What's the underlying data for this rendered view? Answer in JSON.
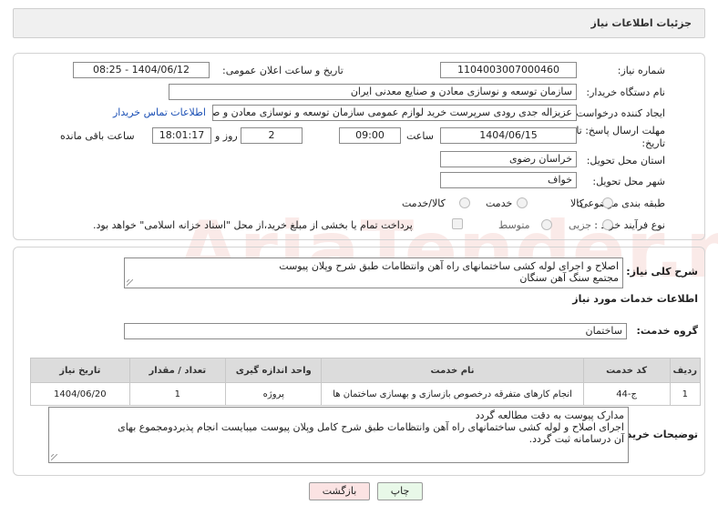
{
  "header": {
    "title": "جزئیات اطلاعات نیاز"
  },
  "need_number": {
    "label": "شماره نیاز:",
    "value": "1104003007000460"
  },
  "announce_datetime": {
    "label": "تاریخ و ساعت اعلان عمومی:",
    "value": "1404/06/12 - 08:25"
  },
  "buyer_org": {
    "label": "نام دستگاه خریدار:",
    "value": "سازمان توسعه و نوسازی معادن و صنایع معدنی ایران"
  },
  "requester": {
    "label": "ایجاد کننده درخواست:",
    "value": "عزیزاله جدی رودی سرپرست خرید لوازم عمومی  سازمان توسعه و نوسازی معادن و صنایع معدنی ایران",
    "contact_link": "اطلاعات تماس خریدار"
  },
  "deadline": {
    "label_line1": "مهلت ارسال پاسخ: تا",
    "label_line2": "تاریخ:",
    "date": "1404/06/15",
    "time_label": "ساعت",
    "time": "09:00",
    "days": "2",
    "days_label": "روز و",
    "remaining": "18:01:17",
    "remaining_label": "ساعت باقی مانده"
  },
  "province": {
    "label": "استان محل تحویل:",
    "value": "خراسان رضوی"
  },
  "city": {
    "label": "شهر محل تحویل:",
    "value": "خواف"
  },
  "category": {
    "label": "طبقه بندی موضوعی:",
    "options": [
      "کالا",
      "خدمت",
      "کالا/خدمت"
    ],
    "selected": "خدمت"
  },
  "purchase_type": {
    "label": "نوع فرآیند خرید :",
    "options": [
      "جزیی",
      "متوسط"
    ],
    "note": "پرداخت تمام یا بخشی از مبلغ خرید،از محل \"اسناد خزانه اسلامی\" خواهد بود."
  },
  "summary": {
    "label": "شرح کلی نیاز:",
    "line1": "اصلاح و اجرای لوله کشی ساختمانهای راه آهن وانتظامات طبق شرح وپلان پیوست",
    "line2": "مجتمع سنگ آهن سنگان"
  },
  "services_section": {
    "title": "اطلاعات خدمات مورد نیاز"
  },
  "service_group": {
    "label": "گروه خدمت:",
    "value": "ساختمان"
  },
  "table": {
    "headers": [
      "ردیف",
      "کد خدمت",
      "نام خدمت",
      "واحد اندازه گیری",
      "تعداد / مقدار",
      "تاریخ نیاز"
    ],
    "rows": [
      [
        "1",
        "ج-44",
        "انجام کارهای متفرقه درخصوص بازسازی و بهسازی ساختمان ها",
        "پروژه",
        "1",
        "1404/06/20"
      ]
    ]
  },
  "buyer_notes": {
    "label": "توضیحات خریدار:",
    "line1": "مدارک پیوست به دقت مطالعه گردد",
    "line2": "اجرای اصلاح و لوله کشی ساختمانهای راه آهن وانتظامات طبق شرح کامل وپلان پیوست  میبایست انجام پذیردومجموع بهای",
    "line3": "آن درسامانه ثبت گردد."
  },
  "buttons": {
    "print": "چاپ",
    "back": "بازگشت"
  },
  "watermark": "AriaTender.neT",
  "colors": {
    "link": "#1a4fb5",
    "back_button": "#fbe3e3",
    "print_button": "#e8f8e8",
    "table_header": "#dcdcdc"
  }
}
